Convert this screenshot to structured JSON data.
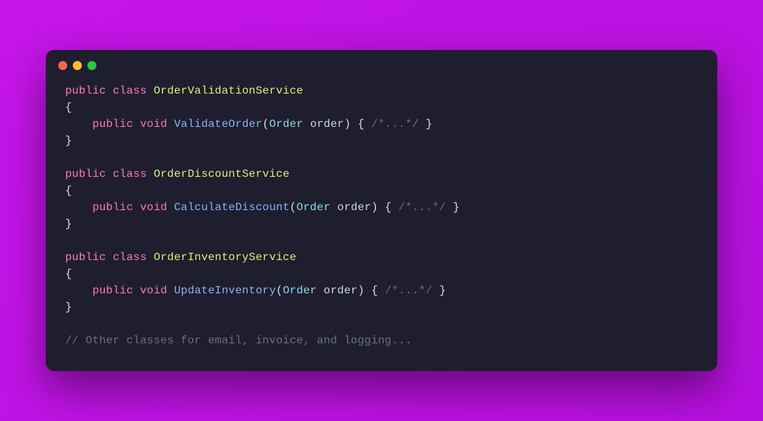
{
  "tokens": {
    "public": "public",
    "class": "class",
    "void": "void"
  },
  "classes": [
    {
      "name": "OrderValidationService",
      "methodName": "ValidateOrder",
      "paramType": "Order",
      "paramName": "order"
    },
    {
      "name": "OrderDiscountService",
      "methodName": "CalculateDiscount",
      "paramType": "Order",
      "paramName": "order"
    },
    {
      "name": "OrderInventoryService",
      "methodName": "UpdateInventory",
      "paramType": "Order",
      "paramName": "order"
    }
  ],
  "inlineComment": "/*...*/",
  "trailingComment": "// Other classes for email, invoice, and logging...",
  "braces": {
    "open": "{",
    "close": "}",
    "openParen": "(",
    "closeParen": ")"
  },
  "indent": "    "
}
